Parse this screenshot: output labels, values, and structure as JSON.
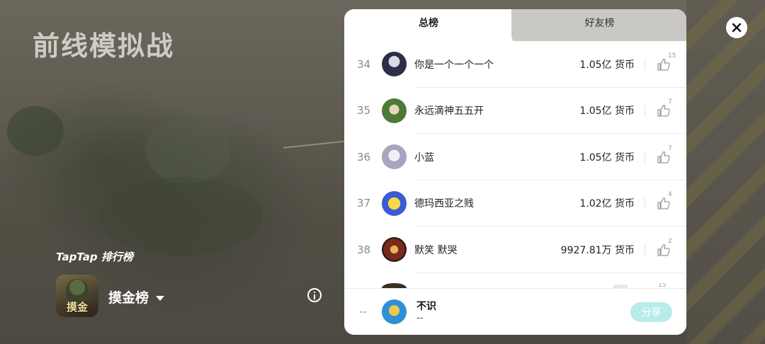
{
  "game": {
    "title": "前线模拟战",
    "icon_text": "摸金"
  },
  "board": {
    "brand_label": "TapTap 排行榜",
    "name": "摸金榜"
  },
  "tabs": [
    {
      "label": "总榜",
      "active": true
    },
    {
      "label": "好友榜",
      "active": false
    }
  ],
  "entries": [
    {
      "rank": "34",
      "name": "你是一个一个一个",
      "score": "1.05亿 货币",
      "likes": "15"
    },
    {
      "rank": "35",
      "name": "永远滴神五五开",
      "score": "1.05亿 货币",
      "likes": "7"
    },
    {
      "rank": "36",
      "name": "小蓝",
      "score": "1.05亿 货币",
      "likes": "7"
    },
    {
      "rank": "37",
      "name": "德玛西亚之贱",
      "score": "1.02亿 货币",
      "likes": "4"
    },
    {
      "rank": "38",
      "name": "默笑 默哭",
      "score": "9927.81万 货币",
      "likes": "2"
    }
  ],
  "next_entry_likes": "15",
  "me": {
    "rank": "--",
    "name": "不识",
    "score": "--",
    "share_label": "分享"
  },
  "colors": {
    "accent": "#b8ecea",
    "panel": "#ffffff",
    "inactive_tab": "#c9c8c5"
  },
  "icons": {
    "close": "close-icon",
    "info": "info-icon",
    "like": "thumbs-up-icon",
    "dropdown": "caret-down-icon"
  }
}
